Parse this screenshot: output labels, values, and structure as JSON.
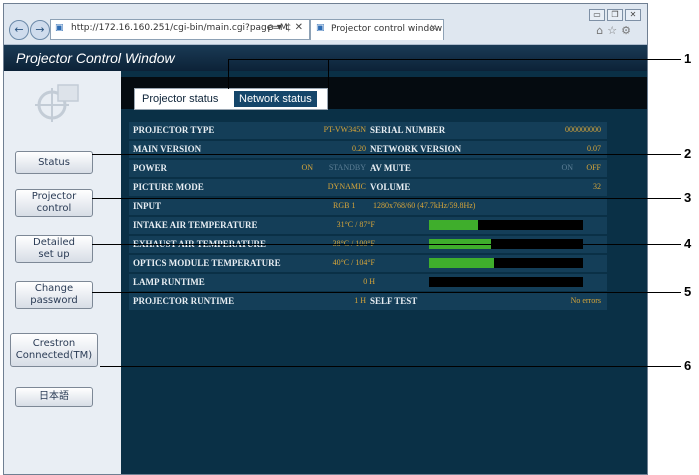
{
  "browser": {
    "url": "http://172.16.160.251/cgi-bin/main.cgi?page=M",
    "address_controls": "ρ ▾ ¢ ✕",
    "tab_title": "Projector control window",
    "tab_close": "×",
    "back": "←",
    "forward": "→",
    "window_controls": [
      "▭",
      "❐",
      "✕"
    ],
    "tools": "⌂☆⚙"
  },
  "app": {
    "title": "Projector Control Window"
  },
  "sidebar": {
    "items": [
      {
        "label": "Status"
      },
      {
        "label": "Projector\ncontrol"
      },
      {
        "label": "Detailed\nset up"
      },
      {
        "label": "Change\npassword"
      },
      {
        "label": "Crestron\nConnected(TM)"
      },
      {
        "label": "日本語"
      }
    ]
  },
  "tabs": [
    {
      "label": "Projector status",
      "active": true
    },
    {
      "label": "Network status",
      "active": false
    }
  ],
  "status": {
    "rows": [
      {
        "left_label": "PROJECTOR TYPE",
        "left_value": "PT-VW345N",
        "right_label": "SERIAL NUMBER",
        "right_value": "000000000"
      },
      {
        "left_label": "MAIN VERSION",
        "left_value": "0.20",
        "right_label": "NETWORK VERSION",
        "right_value": "0.07"
      },
      {
        "left_label": "POWER",
        "left_value": "ON",
        "left_value2": "STANDBY",
        "right_label": "AV MUTE",
        "right_value": "ON",
        "right_value2": "OFF"
      },
      {
        "left_label": "PICTURE MODE",
        "left_value": "DYNAMIC",
        "right_label": "VOLUME",
        "right_value": "32"
      },
      {
        "left_label": "INPUT",
        "left_value": "RGB 1",
        "left_value2": "1280x768/60 (47.7kHz/59.8Hz)"
      },
      {
        "left_label": "INTAKE AIR TEMPERATURE",
        "left_value": "31°C / 87°F",
        "bar_fill": 0.32
      },
      {
        "left_label": "EXHAUST AIR TEMPERATURE",
        "left_value": "38°C / 100°F",
        "bar_fill": 0.4
      },
      {
        "left_label": "OPTICS MODULE TEMPERATURE",
        "left_value": "40°C / 104°F",
        "bar_fill": 0.42
      },
      {
        "left_label": "LAMP RUNTIME",
        "left_value": "0 H"
      },
      {
        "left_label": "PROJECTOR RUNTIME",
        "left_value": "1 H",
        "right_label": "SELF TEST",
        "right_value": "No errors"
      }
    ]
  },
  "callouts": [
    "1",
    "2",
    "3",
    "4",
    "5",
    "6"
  ]
}
